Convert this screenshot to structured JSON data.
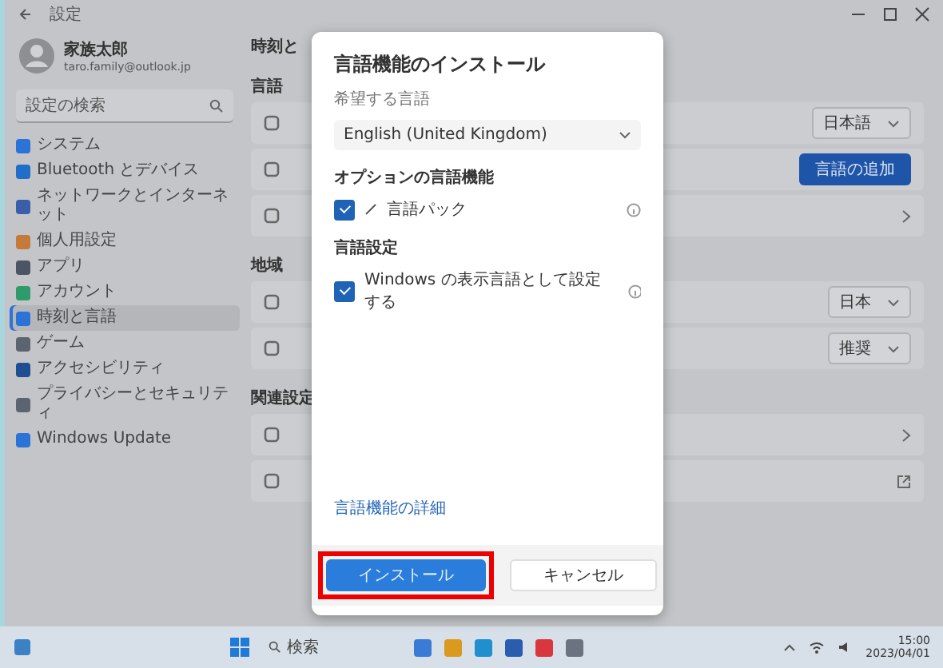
{
  "window": {
    "title": "設定"
  },
  "profile": {
    "name": "家族太郎",
    "email": "taro.family@outlook.jp"
  },
  "search": {
    "placeholder": "設定の検索"
  },
  "sidebar": {
    "items": [
      {
        "label": "システム",
        "selected": false,
        "color": "#2b73d6"
      },
      {
        "label": "Bluetooth とデバイス",
        "selected": false,
        "color": "#1f6fc9"
      },
      {
        "label": "ネットワークとインターネット",
        "selected": false,
        "color": "#3a5fa8"
      },
      {
        "label": "個人用設定",
        "selected": false,
        "color": "#c47a3a"
      },
      {
        "label": "アプリ",
        "selected": false,
        "color": "#4b5563"
      },
      {
        "label": "アカウント",
        "selected": false,
        "color": "#2f9a6a"
      },
      {
        "label": "時刻と言語",
        "selected": true,
        "color": "#2b73d6"
      },
      {
        "label": "ゲーム",
        "selected": false,
        "color": "#5b6470"
      },
      {
        "label": "アクセシビリティ",
        "selected": false,
        "color": "#1d4f91"
      },
      {
        "label": "プライバシーとセキュリティ",
        "selected": false,
        "color": "#5b6470"
      },
      {
        "label": "Windows Update",
        "selected": false,
        "color": "#2b73d6"
      }
    ]
  },
  "page": {
    "title": "時刻と",
    "sections": [
      {
        "heading": "言語",
        "rows": [
          {
            "kind": "dropdown",
            "value": "日本語"
          },
          {
            "kind": "button",
            "label": "言語の追加"
          },
          {
            "kind": "chevron"
          }
        ]
      },
      {
        "heading": "地域",
        "rows": [
          {
            "kind": "dropdown",
            "value": "日本"
          },
          {
            "kind": "dropdown",
            "value": "推奨"
          }
        ]
      },
      {
        "heading": "関連設定",
        "rows": [
          {
            "kind": "chevron"
          },
          {
            "kind": "external"
          }
        ]
      }
    ]
  },
  "dialog": {
    "title": "言語機能のインストール",
    "language_label": "希望する言語",
    "language_value": "English (United Kingdom)",
    "groups": [
      {
        "heading": "オプションの言語機能",
        "options": [
          {
            "label": "言語パック",
            "checked": true
          }
        ]
      },
      {
        "heading": "言語設定",
        "options": [
          {
            "label": "Windows の表示言語として設定する",
            "checked": true
          }
        ]
      }
    ],
    "link": "言語機能の詳細",
    "primary_button": "インストール",
    "secondary_button": "キャンセル",
    "highlighted": true
  },
  "taskbar": {
    "search_label": "検索",
    "apps": [
      {
        "color": "#3a7bd5"
      },
      {
        "color": "#d99a1e"
      },
      {
        "color": "#1f8fcf"
      },
      {
        "color": "#2a5db0"
      },
      {
        "color": "#d9363e"
      },
      {
        "color": "#6b7280"
      }
    ],
    "time": "15:00",
    "date": "2023/04/01"
  }
}
